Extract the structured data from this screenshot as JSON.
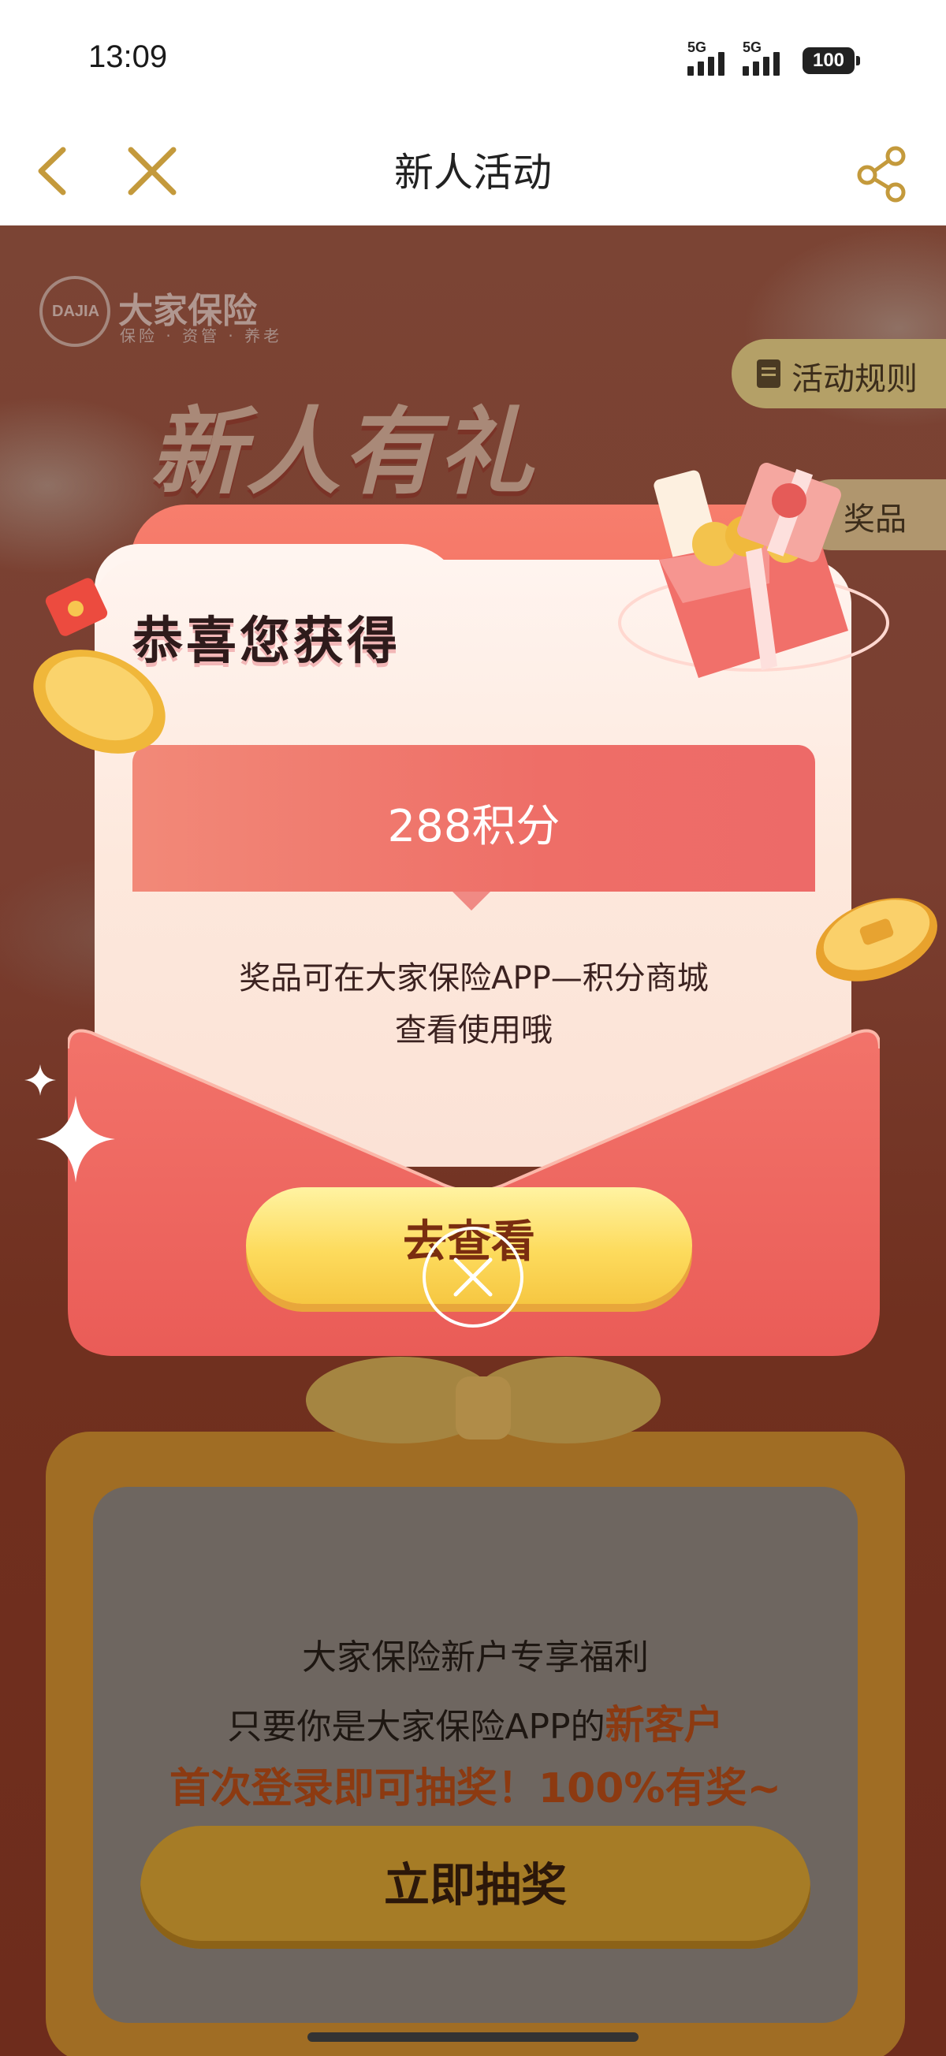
{
  "status_bar": {
    "time": "13:09",
    "network_1": "5G",
    "network_2": "5G",
    "battery": "100"
  },
  "nav": {
    "title": "新人活动",
    "icons": [
      "back-icon",
      "close-icon",
      "share-icon"
    ]
  },
  "background": {
    "logo_mark": "DAJIA",
    "logo_name": "大家保险",
    "logo_sub": "保险 · 资管 · 养老",
    "headline": "新人有礼",
    "rules_button": "活动规则",
    "prize_button": "奖品"
  },
  "bottom_card": {
    "line1": "大家保险新户专享福利",
    "line2_prefix": "只要你是大家保险APP的",
    "line2_highlight": "新客户",
    "line3": "首次登录即可抽奖！100%有奖~",
    "draw_button": "立即抽奖"
  },
  "modal": {
    "congrats": "恭喜您获得",
    "prize": "288积分",
    "desc_line1": "奖品可在大家保险APP—积分商城",
    "desc_line2": "查看使用哦",
    "button": "去查看",
    "close_icon": "close-icon"
  },
  "colors": {
    "accent_gold": "#c49a3c",
    "prize_red": "#ee6e67",
    "button_yellow": "#fddb5d",
    "button_text": "#7a2d10"
  }
}
